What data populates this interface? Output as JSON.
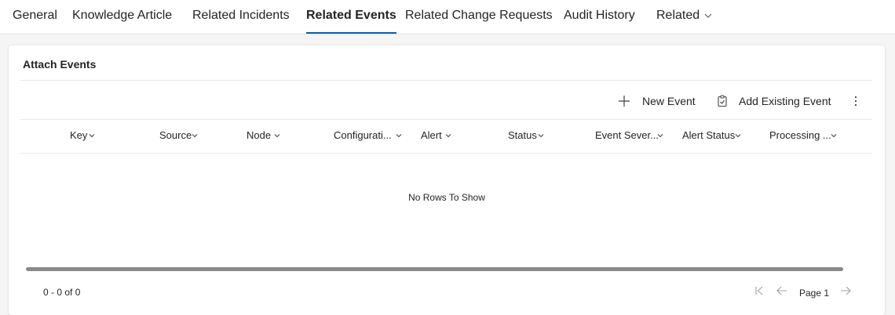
{
  "tabs": [
    {
      "label": "General"
    },
    {
      "label": "Knowledge Article"
    },
    {
      "label": "Related Incidents"
    },
    {
      "label": "Related Events",
      "active": true
    },
    {
      "label": "Related Change Requests"
    },
    {
      "label": "Audit History"
    },
    {
      "label": "Related"
    }
  ],
  "section": {
    "title": "Attach Events"
  },
  "commands": {
    "new_event": "New Event",
    "add_existing_event": "Add Existing Event"
  },
  "grid": {
    "columns": [
      "Key",
      "Source",
      "Node",
      "Configurati...",
      "Alert",
      "Status",
      "Event Sever...",
      "Alert Status",
      "Processing ..."
    ],
    "empty_message": "No Rows To Show"
  },
  "footer": {
    "count": "0 - 0 of 0",
    "page_label": "Page 1"
  },
  "colors": {
    "accent": "#115ea3",
    "scrollbar": "#8a8a8a",
    "disabled_icon": "#a0a0a0"
  }
}
